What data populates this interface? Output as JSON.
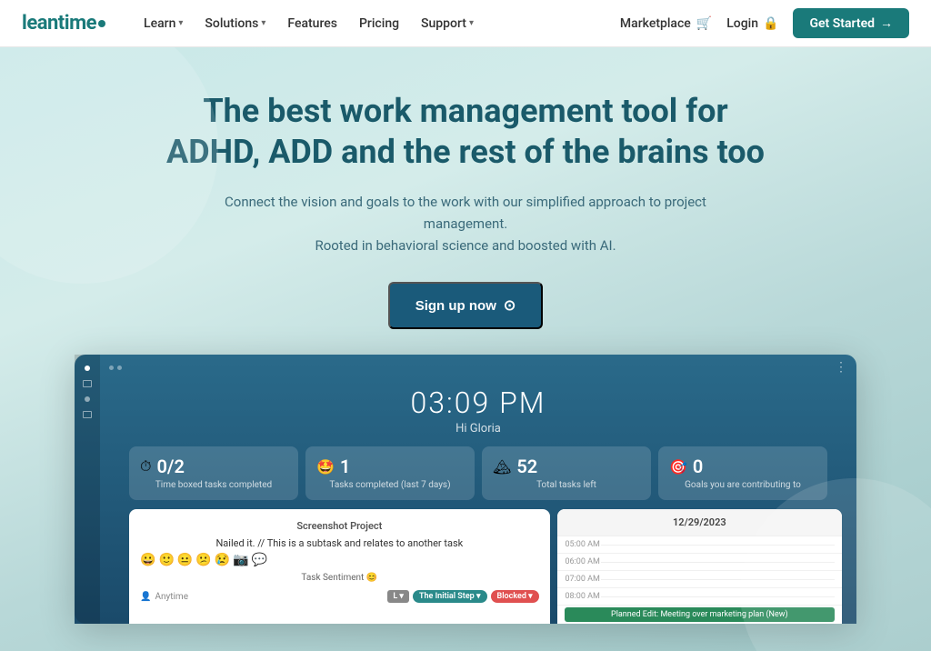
{
  "nav": {
    "logo": "leantime",
    "links": [
      {
        "label": "Learn",
        "has_dropdown": true
      },
      {
        "label": "Solutions",
        "has_dropdown": true
      },
      {
        "label": "Features",
        "has_dropdown": false
      },
      {
        "label": "Pricing",
        "has_dropdown": false
      },
      {
        "label": "Support",
        "has_dropdown": true
      }
    ],
    "marketplace_label": "Marketplace",
    "login_label": "Login",
    "cta_label": "Get Started",
    "cta_arrow": "→"
  },
  "hero": {
    "title_line1": "The best work management tool for",
    "title_line2": "ADHD, ADD and the rest of the brains too",
    "subtitle_line1": "Connect the vision and goals to the work with our simplified approach to project management.",
    "subtitle_line2": "Rooted in behavioral science and boosted with AI.",
    "cta_label": "Sign up now",
    "cta_icon": "⊙"
  },
  "app_preview": {
    "time": "03:09 PM",
    "greeting": "Hi Gloria",
    "stats": [
      {
        "emoji": "⏱",
        "value": "0/2",
        "label": "Time boxed tasks completed"
      },
      {
        "emoji": "🤩",
        "value": "1",
        "label": "Tasks completed (last 7 days)"
      },
      {
        "emoji": "🏔",
        "value": "52",
        "label": "Total tasks left"
      },
      {
        "emoji": "🎯",
        "value": "0",
        "label": "Goals you are contributing to"
      }
    ],
    "task": {
      "project": "Screenshot Project",
      "title_green": "Nailed it. // This is a subtask and relates to another task",
      "emojis": [
        "😀",
        "🙂",
        "😐",
        "😕",
        "😢",
        "📷",
        "💬"
      ],
      "sentiment_label": "Task Sentiment 😊",
      "time_label": "Anytime",
      "badge_l": "L ▾",
      "badge_step": "The Initial Step ▾",
      "badge_blocked": "Blocked ▾"
    },
    "calendar": {
      "date": "12/29/2023",
      "times": [
        "05:00 AM",
        "06:00 AM",
        "07:00 AM",
        "08:00 AM"
      ],
      "event": "Planned Edit: Meeting over marketing plan (New)"
    }
  }
}
